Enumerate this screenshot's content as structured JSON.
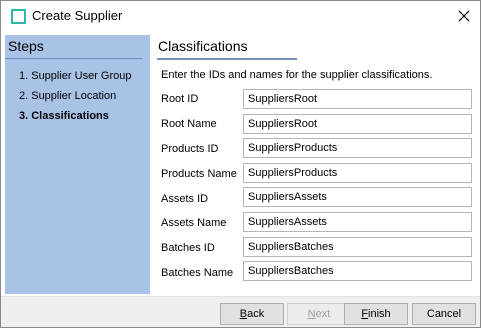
{
  "window": {
    "title": "Create Supplier",
    "accent_color": "#2fb5a5"
  },
  "steps": {
    "heading": "Steps",
    "items": [
      {
        "label": "1. Supplier User Group",
        "current": false
      },
      {
        "label": "2. Supplier Location",
        "current": false
      },
      {
        "label": "3. Classifications",
        "current": true
      }
    ],
    "panel_color": "#a9c3e6"
  },
  "content": {
    "heading": "Classifications",
    "instruction": "Enter the IDs and names for the supplier classifications.",
    "fields": [
      {
        "label": "Root ID",
        "value": "SuppliersRoot"
      },
      {
        "label": "Root Name",
        "value": "SuppliersRoot"
      },
      {
        "label": "Products ID",
        "value": "SuppliersProducts"
      },
      {
        "label": "Products Name",
        "value": "SuppliersProducts"
      },
      {
        "label": "Assets ID",
        "value": "SuppliersAssets"
      },
      {
        "label": "Assets Name",
        "value": "SuppliersAssets"
      },
      {
        "label": "Batches ID",
        "value": "SuppliersBatches"
      },
      {
        "label": "Batches Name",
        "value": "SuppliersBatches"
      }
    ]
  },
  "footer": {
    "back": {
      "mnemonic": "B",
      "rest": "ack",
      "enabled": true
    },
    "next": {
      "mnemonic": "N",
      "rest": "ext",
      "enabled": false
    },
    "finish": {
      "mnemonic": "F",
      "rest": "inish",
      "enabled": true
    },
    "cancel": {
      "label": "Cancel",
      "enabled": true
    }
  },
  "icons": {
    "window_icon": "window-icon",
    "close": "close-icon"
  }
}
